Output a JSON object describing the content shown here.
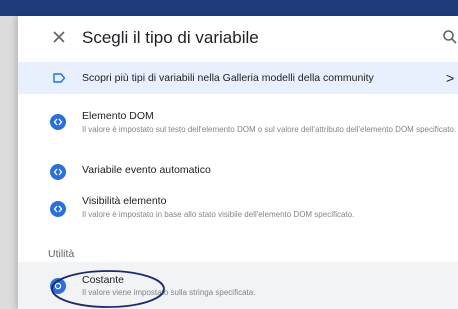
{
  "dialog": {
    "title": "Scegli il tipo di variabile",
    "close_icon": "close-icon",
    "search_icon": "search-icon"
  },
  "banner": {
    "text": "Scopri più tipi di variabili nella Galleria modelli della community",
    "icon": "tag-outline-icon",
    "chevron": ">"
  },
  "items": [
    {
      "name": "Elemento DOM",
      "description": "Il valore è impostato sul testo dell'elemento DOM o sul valore dell'attributo dell'elemento DOM specificato.",
      "icon": "code-circle-icon"
    },
    {
      "name": "Variabile evento automatico",
      "description": "",
      "icon": "code-circle-icon"
    },
    {
      "name": "Visibilità elemento",
      "description": "Il valore è impostato in base allo stato visibile dell'elemento DOM specificato.",
      "icon": "code-circle-icon"
    }
  ],
  "section": {
    "label": "Utilità"
  },
  "selected_item": {
    "name": "Costante",
    "description": "Il valore viene impostato sulla stringa specificata.",
    "icon": "constant-circle-icon",
    "highlight_color": "#1a2a6c"
  },
  "colors": {
    "accent": "#2a6fdb",
    "banner_bg": "#e8f0fe",
    "topbar": "#1f3b7a"
  }
}
